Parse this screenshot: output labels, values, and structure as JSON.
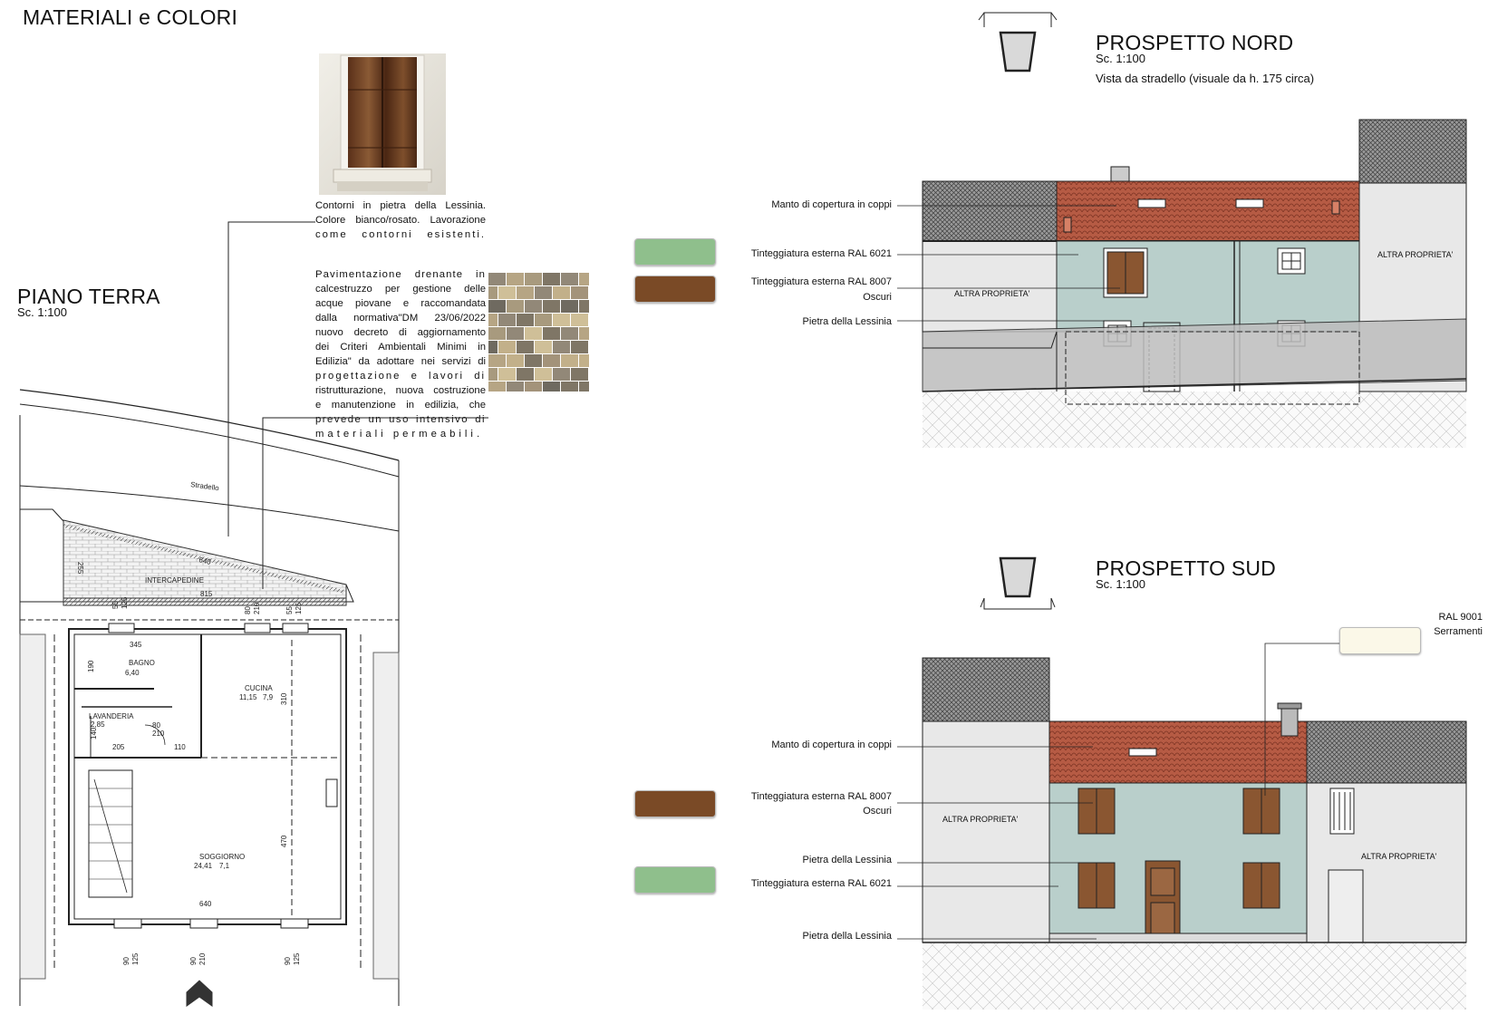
{
  "header": {
    "title": "MATERIALI e COLORI"
  },
  "piano_terra": {
    "title": "PIANO TERRA",
    "scale": "Sc. 1:100",
    "street_label": "Stradello",
    "rooms": {
      "intercapedine": "INTERCAPEDINE",
      "bagno": "BAGNO",
      "bagno_area": "6,40",
      "cucina": "CUCINA",
      "cucina_area": "11,15",
      "cucina_ratio": "7,9",
      "lavanderia": "LAVANDERIA",
      "lavanderia_area": "2,85",
      "soggiorno": "SOGGIORNO",
      "soggiorno_area": "24,41",
      "soggiorno_ratio": "7,1"
    },
    "dimensions": {
      "d640_top": "640",
      "d815": "815",
      "d255": "255",
      "d55_a": "55",
      "d125_a": "125",
      "d80_a": "80",
      "d210_a": "210",
      "d55_b": "55",
      "d125_b": "125",
      "d345": "345",
      "d190": "190",
      "d310": "310",
      "d80_b": "80",
      "d210_b": "210",
      "d140": "140",
      "d205": "205",
      "d110": "110",
      "d470": "470",
      "d640_bottom": "640",
      "d90_a": "90",
      "d125_c": "125",
      "d90_b": "90",
      "d210_c": "210",
      "d90_c": "90",
      "d125_d": "125"
    }
  },
  "notes": {
    "contorni_lines": [
      "Contorni in pietra della Lessinia.",
      "Colore bianco/rosato. Lavorazione",
      "come contorni esistenti."
    ],
    "pavimentazione_lines": [
      "Pavimentazione drenante in",
      "calcestruzzo per gestione delle",
      "acque piovane e  raccomandata",
      "dalla normativa\"DM 23/06/2022",
      "nuovo decreto di aggiornamento",
      "dei Criteri Ambientali Minimi in",
      "Edilizia\" da adottare nei servizi di",
      "progettazione e lavori di",
      "ristrutturazione, nuova costruzione",
      "e manutenzione in edilizia, che",
      "prevede un uso intensivo di",
      "materiali permeabili."
    ]
  },
  "prospetto_nord": {
    "title": "PROSPETTO NORD",
    "scale": "Sc. 1:100",
    "subtitle": "Vista da stradello (visuale da h. 175 circa)",
    "labels": {
      "manto": "Manto di copertura in coppi",
      "tinteggiatura_6021": "Tinteggiatura esterna RAL 6021",
      "tinteggiatura_8007": "Tinteggiatura esterna RAL 8007",
      "oscuri": "Oscuri",
      "pietra": "Pietra della Lessinia",
      "altra_left": "ALTRA PROPRIETA'",
      "altra_right": "ALTRA PROPRIETA'"
    }
  },
  "prospetto_sud": {
    "title": "PROSPETTO SUD",
    "scale": "Sc. 1:100",
    "labels": {
      "ral9001": "RAL 9001",
      "serramenti": "Serramenti",
      "manto": "Manto di copertura in coppi",
      "tinteggiatura_8007": "Tinteggiatura esterna RAL 8007",
      "oscuri": "Oscuri",
      "pietra_1": "Pietra della Lessinia",
      "tinteggiatura_6021": "Tinteggiatura esterna RAL 6021",
      "pietra_2": "Pietra della Lessinia",
      "altra_left": "ALTRA PROPRIETA'",
      "altra_right": "ALTRA PROPRIETA'"
    }
  },
  "colors": {
    "ral6021": "#8fbf8c",
    "ral8007": "#7a4a26",
    "ral9001": "#fbf8e8",
    "facade": "#b9cfcb",
    "roof": "#b55a43",
    "neighbor": "#e8e8e8",
    "stone": "#bdbdbd"
  }
}
